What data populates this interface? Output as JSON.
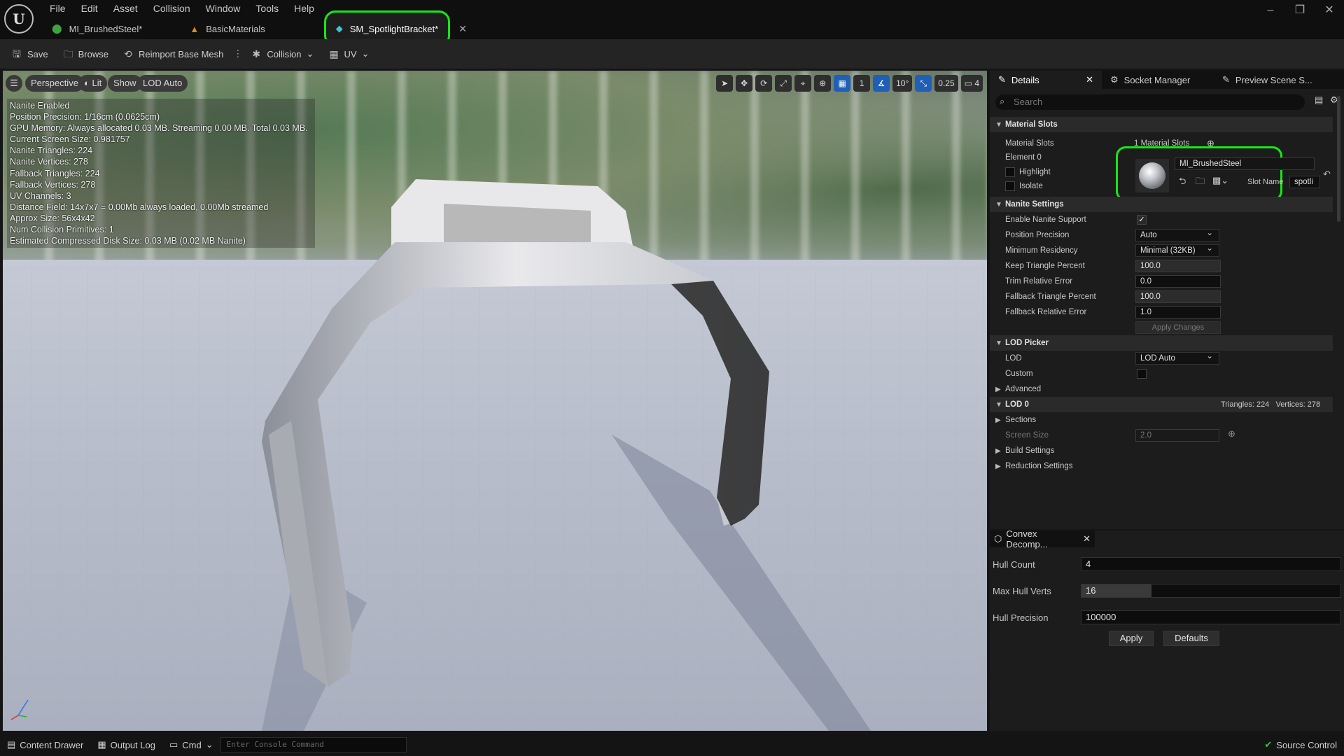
{
  "menu": [
    "File",
    "Edit",
    "Asset",
    "Collision",
    "Window",
    "Tools",
    "Help"
  ],
  "tabs": [
    {
      "label": "MI_BrushedSteel*"
    },
    {
      "label": "BasicMaterials"
    },
    {
      "label": "SM_SpotlightBracket*",
      "active": true
    }
  ],
  "toolbar": {
    "save": "Save",
    "browse": "Browse",
    "reimport": "Reimport Base Mesh",
    "collision": "Collision",
    "uv": "UV"
  },
  "viewport": {
    "perspective": "Perspective",
    "lit": "Lit",
    "show": "Show",
    "lod": "LOD Auto",
    "tools": {
      "grid": "1",
      "angle": "10°",
      "scale": "0.25",
      "camera": "4"
    },
    "stats": [
      "Nanite Enabled",
      "Position Precision: 1/16cm (0.0625cm)",
      "GPU Memory: Always allocated 0.03 MB. Streaming 0.00 MB. Total 0.03 MB.",
      "Current Screen Size: 0.981757",
      "Nanite Triangles: 224",
      "Nanite Vertices: 278",
      "Fallback Triangles: 224",
      "Fallback Vertices: 278",
      "UV Channels: 3",
      "Distance Field: 14x7x7 = 0.00Mb always loaded, 0.00Mb streamed",
      "Approx Size: 56x4x42",
      "Num Collision Primitives: 1",
      "Estimated Compressed Disk Size: 0.03 MB (0.02 MB Nanite)"
    ]
  },
  "details": {
    "tabs": [
      "Details",
      "Socket Manager",
      "Preview Scene S..."
    ],
    "search_placeholder": "Search",
    "material_slots": {
      "header": "Material Slots",
      "label": "Material Slots",
      "count": "1 Material Slots",
      "element": "Element 0",
      "highlight": "Highlight",
      "isolate": "Isolate",
      "material": "MI_BrushedSteel",
      "slot_name_label": "Slot Name",
      "slot_name": "spotli"
    },
    "nanite": {
      "header": "Nanite Settings",
      "enable": "Enable Nanite Support",
      "position_precision": "Position Precision",
      "position_precision_val": "Auto",
      "min_residency": "Minimum Residency",
      "min_residency_val": "Minimal (32KB)",
      "keep_tri": "Keep Triangle Percent",
      "keep_tri_val": "100.0",
      "trim": "Trim Relative Error",
      "trim_val": "0.0",
      "fallback_tri": "Fallback Triangle Percent",
      "fallback_tri_val": "100.0",
      "fallback_err": "Fallback Relative Error",
      "fallback_err_val": "1.0",
      "apply": "Apply Changes"
    },
    "lod_picker": {
      "header": "LOD Picker",
      "lod": "LOD",
      "lod_val": "LOD Auto",
      "custom": "Custom",
      "advanced": "Advanced"
    },
    "lod0": {
      "header": "LOD 0",
      "stats": "Triangles: 224   Vertices: 278",
      "sections": "Sections",
      "screen_size": "Screen Size",
      "screen_size_val": "2.0",
      "build": "Build Settings",
      "reduction": "Reduction Settings"
    }
  },
  "convex": {
    "title": "Convex Decomp...",
    "hull_count": "Hull Count",
    "hull_count_val": "4",
    "max_verts": "Max Hull Verts",
    "max_verts_val": "16",
    "max_verts_fill": 0.27,
    "precision": "Hull Precision",
    "precision_val": "100000",
    "apply": "Apply",
    "defaults": "Defaults"
  },
  "status": {
    "content": "Content Drawer",
    "output": "Output Log",
    "cmd": "Cmd",
    "console_placeholder": "Enter Console Command",
    "source": "Source Control"
  }
}
